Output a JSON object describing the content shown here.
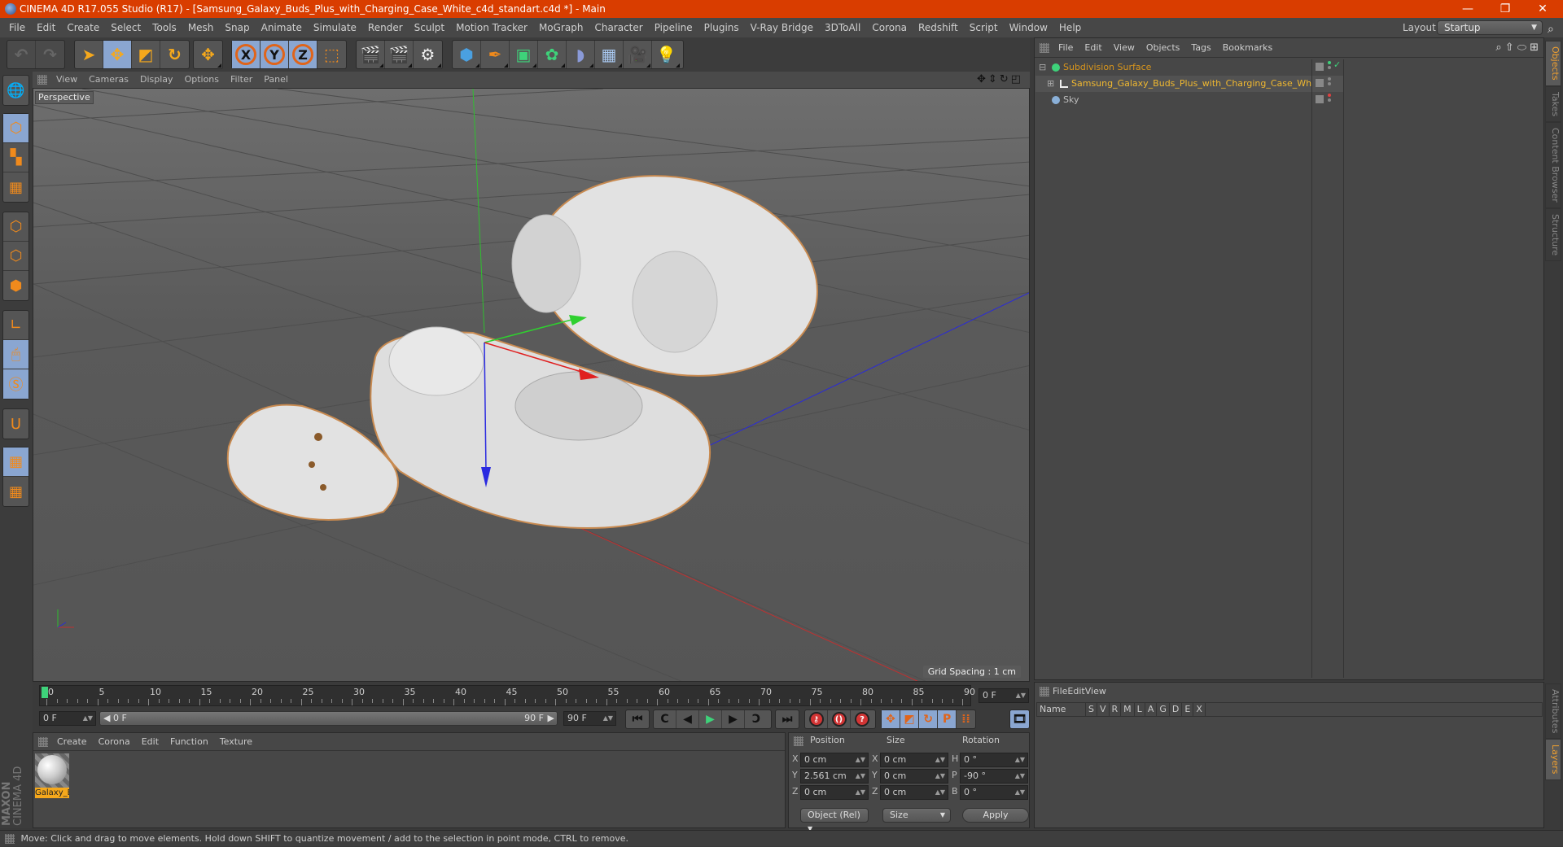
{
  "window": {
    "title": "CINEMA 4D R17.055 Studio (R17) - [Samsung_Galaxy_Buds_Plus_with_Charging_Case_White_c4d_standart.c4d *] - Main",
    "controls": {
      "minimize": "—",
      "restore": "❐",
      "close": "✕"
    }
  },
  "menubar": {
    "items": [
      "File",
      "Edit",
      "Create",
      "Select",
      "Tools",
      "Mesh",
      "Snap",
      "Animate",
      "Simulate",
      "Render",
      "Sculpt",
      "Motion Tracker",
      "MoGraph",
      "Character",
      "Pipeline",
      "Plugins",
      "V-Ray Bridge",
      "3DToAll",
      "Corona",
      "Redshift",
      "Script",
      "Window",
      "Help"
    ],
    "layout_label": "Layout:",
    "layout_value": "Startup"
  },
  "toolbar": {
    "undo_redo": [
      {
        "icon": "undo-icon",
        "glyph": "↶"
      },
      {
        "icon": "redo-icon",
        "glyph": "↷"
      }
    ],
    "modes": [
      {
        "icon": "select-pointer-icon",
        "glyph": "➤",
        "active": false
      },
      {
        "icon": "move-icon",
        "glyph": "✥",
        "active": true
      },
      {
        "icon": "scale-icon",
        "glyph": "◩",
        "active": false
      },
      {
        "icon": "rotate-icon",
        "glyph": "↻",
        "active": false
      }
    ],
    "last_tool": {
      "icon": "move-icon",
      "glyph": "✥"
    },
    "axes": [
      {
        "label": "X"
      },
      {
        "label": "Y"
      },
      {
        "label": "Z"
      }
    ],
    "coord_system": {
      "icon": "world-coordinate-icon",
      "glyph": "⬚"
    },
    "render": [
      {
        "icon": "render-view-icon",
        "glyph": "🎬"
      },
      {
        "icon": "render-picture-viewer-icon",
        "glyph": "🎬"
      },
      {
        "icon": "render-settings-icon",
        "glyph": "⚙"
      }
    ],
    "objects": [
      {
        "icon": "cube-icon",
        "glyph": "⬢",
        "color": "#4aa0e0"
      },
      {
        "icon": "pen-spline-icon",
        "glyph": "✒",
        "color": "#f08a1c"
      },
      {
        "icon": "subdivision-surface-icon",
        "glyph": "▣",
        "color": "#3ed27a"
      },
      {
        "icon": "cloner-icon",
        "glyph": "✿",
        "color": "#3ed27a"
      },
      {
        "icon": "bend-deformer-icon",
        "glyph": "◗",
        "color": "#8a9ad8"
      },
      {
        "icon": "floor-icon",
        "glyph": "▦",
        "color": "#a8c8f0"
      },
      {
        "icon": "camera-icon",
        "glyph": "🎥",
        "color": "#111"
      },
      {
        "icon": "light-icon",
        "glyph": "💡",
        "color": "#eee"
      }
    ]
  },
  "lefttools": {
    "groups": [
      [
        {
          "icon": "make-editable-icon",
          "glyph": "🌐",
          "active": false
        }
      ],
      [
        {
          "icon": "model-mode-icon",
          "glyph": "⬡",
          "active": true
        },
        {
          "icon": "texture-mode-icon",
          "glyph": "▚",
          "active": false
        },
        {
          "icon": "workplane-mode-icon",
          "glyph": "▦",
          "active": false
        }
      ],
      [
        {
          "icon": "points-mode-icon",
          "glyph": "⬡",
          "active": false
        },
        {
          "icon": "edges-mode-icon",
          "glyph": "⬡",
          "active": false
        },
        {
          "icon": "polygons-mode-icon",
          "glyph": "⬢",
          "active": false
        }
      ],
      [
        {
          "icon": "axis-mode-icon",
          "glyph": "∟",
          "active": false
        },
        {
          "icon": "tweak-mode-icon",
          "glyph": "🖱",
          "active": true
        },
        {
          "icon": "solo-mode-icon",
          "glyph": "Ⓢ",
          "active": true
        }
      ],
      [
        {
          "icon": "snap-magnet-icon",
          "glyph": "U",
          "active": false
        }
      ],
      [
        {
          "icon": "locked-workplane-icon",
          "glyph": "▦",
          "active": true
        },
        {
          "icon": "planar-workplane-icon",
          "glyph": "▦",
          "active": false
        }
      ]
    ]
  },
  "viewport": {
    "menu": [
      "View",
      "Cameras",
      "Display",
      "Options",
      "Filter",
      "Panel"
    ],
    "label": "Perspective",
    "grid_spacing": "Grid Spacing : 1 cm",
    "nav_icons": [
      {
        "icon": "pan-icon",
        "glyph": "✥"
      },
      {
        "icon": "dolly-icon",
        "glyph": "⇕"
      },
      {
        "icon": "orbit-icon",
        "glyph": "↻"
      },
      {
        "icon": "maximize-view-icon",
        "glyph": "◰"
      }
    ]
  },
  "object_manager": {
    "menu": [
      "File",
      "Edit",
      "View",
      "Objects",
      "Tags",
      "Bookmarks"
    ],
    "objects": [
      {
        "name": "Subdivision Surface",
        "icon": "subdivision-surface-icon",
        "color": "#d8951c",
        "expander": "⊟",
        "indent": 0,
        "status": "✓",
        "status_color": "#3ed27a"
      },
      {
        "name": "Samsung_Galaxy_Buds_Plus_with_Charging_Case_White",
        "icon": "null-object-icon",
        "color": "#f0b830",
        "expander": "⊞",
        "indent": 1,
        "status": "",
        "status_color": "#888"
      },
      {
        "name": "Sky",
        "icon": "sky-icon",
        "color": "#bdbdbd",
        "expander": "",
        "indent": 0,
        "status": "",
        "status_color": "#e04040"
      }
    ],
    "side_tabs": [
      "Objects",
      "Takes",
      "Content Browser",
      "Structure"
    ]
  },
  "layer_manager": {
    "menu": [
      "File",
      "Edit",
      "View"
    ],
    "columns": [
      "Name",
      "S",
      "V",
      "R",
      "M",
      "L",
      "A",
      "G",
      "D",
      "E",
      "X"
    ],
    "side_tabs": [
      "Attributes",
      "Layers"
    ]
  },
  "timeline": {
    "ticks": [
      "0",
      "5",
      "10",
      "15",
      "20",
      "25",
      "30",
      "35",
      "40",
      "45",
      "50",
      "55",
      "60",
      "65",
      "70",
      "75",
      "80",
      "85",
      "90"
    ],
    "current_frame": "0 F",
    "start_frame": "0 F",
    "range_start": "0 F",
    "range_end": "90 F",
    "end_frame": "90 F",
    "playback": [
      {
        "icon": "go-to-start-icon",
        "glyph": "⏮"
      },
      {
        "icon": "previous-key-icon",
        "glyph": "C"
      },
      {
        "icon": "previous-frame-icon",
        "glyph": "◀"
      },
      {
        "icon": "play-icon",
        "glyph": "▶"
      },
      {
        "icon": "next-frame-icon",
        "glyph": "▶"
      },
      {
        "icon": "next-key-icon",
        "glyph": "Ↄ"
      },
      {
        "icon": "go-to-end-icon",
        "glyph": "⏭"
      }
    ],
    "record": [
      {
        "icon": "record-keys-icon",
        "glyph": "⚷"
      },
      {
        "icon": "autokeying-icon",
        "glyph": "()"
      },
      {
        "icon": "keyframe-selection-icon",
        "glyph": "?"
      }
    ],
    "key_modes": [
      {
        "icon": "key-position-icon",
        "glyph": "✥"
      },
      {
        "icon": "key-scale-icon",
        "glyph": "◩"
      },
      {
        "icon": "key-rotation-icon",
        "glyph": "↻"
      },
      {
        "icon": "key-parameter-icon",
        "glyph": "P"
      },
      {
        "icon": "key-pla-icon",
        "glyph": "⁞⁞"
      }
    ],
    "timeline_button": {
      "icon": "timeline-film-icon",
      "glyph": "🎞"
    }
  },
  "material_manager": {
    "menu": [
      "Create",
      "Corona",
      "Edit",
      "Function",
      "Texture"
    ],
    "materials": [
      {
        "name": "Galaxy_B"
      }
    ]
  },
  "branding": {
    "maxon": "MAXON",
    "cinema": "CINEMA 4D"
  },
  "coordinates": {
    "headers": [
      "Position",
      "Size",
      "Rotation"
    ],
    "rows": [
      {
        "pos_axis": "X",
        "pos": "0 cm",
        "size_axis": "X",
        "size": "0 cm",
        "rot_axis": "H",
        "rot": "0 °"
      },
      {
        "pos_axis": "Y",
        "pos": "2.561 cm",
        "size_axis": "Y",
        "size": "0 cm",
        "rot_axis": "P",
        "rot": "-90 °"
      },
      {
        "pos_axis": "Z",
        "pos": "0 cm",
        "size_axis": "Z",
        "size": "0 cm",
        "rot_axis": "B",
        "rot": "0 °"
      }
    ],
    "mode_select": "Object (Rel)",
    "size_select": "Size",
    "apply_label": "Apply"
  },
  "statusbar": {
    "text": "Move: Click and drag to move elements. Hold down SHIFT to quantize movement / add to the selection in point mode, CTRL to remove."
  }
}
